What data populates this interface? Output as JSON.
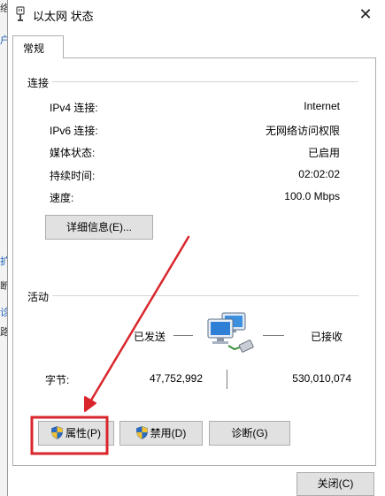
{
  "background_window": {
    "fragments": [
      "络",
      "户",
      "扩",
      "断",
      "诊",
      "路"
    ]
  },
  "dialog": {
    "title": "以太网 状态",
    "close_glyph": "✕"
  },
  "tabs": [
    {
      "label": "常规",
      "selected": true
    }
  ],
  "connection": {
    "section_label": "连接",
    "rows": [
      {
        "label": "IPv4 连接:",
        "value": "Internet"
      },
      {
        "label": "IPv6 连接:",
        "value": "无网络访问权限"
      },
      {
        "label": "媒体状态:",
        "value": "已启用"
      },
      {
        "label": "持续时间:",
        "value": "02:02:02"
      },
      {
        "label": "速度:",
        "value": "100.0 Mbps"
      }
    ],
    "details_button": "详细信息(E)..."
  },
  "activity": {
    "section_label": "活动",
    "sent_label": "已发送",
    "received_label": "已接收",
    "bytes_label": "字节:",
    "bytes_sent": "47,752,992",
    "bytes_received": "530,010,074"
  },
  "buttons": {
    "properties": "属性(P)",
    "disable": "禁用(D)",
    "diagnose": "诊断(G)",
    "close": "关闭(C)"
  },
  "annotation": {
    "color": "#d9262c"
  },
  "colors": {
    "button_face": "#e1e1e1",
    "button_border": "#adadad",
    "shield_blue": "#2b6cc4",
    "shield_yellow": "#f2c230"
  },
  "icons": {
    "title": "network-adapter-icon",
    "activity": "network-computers-icon",
    "shield": "uac-shield-icon"
  }
}
